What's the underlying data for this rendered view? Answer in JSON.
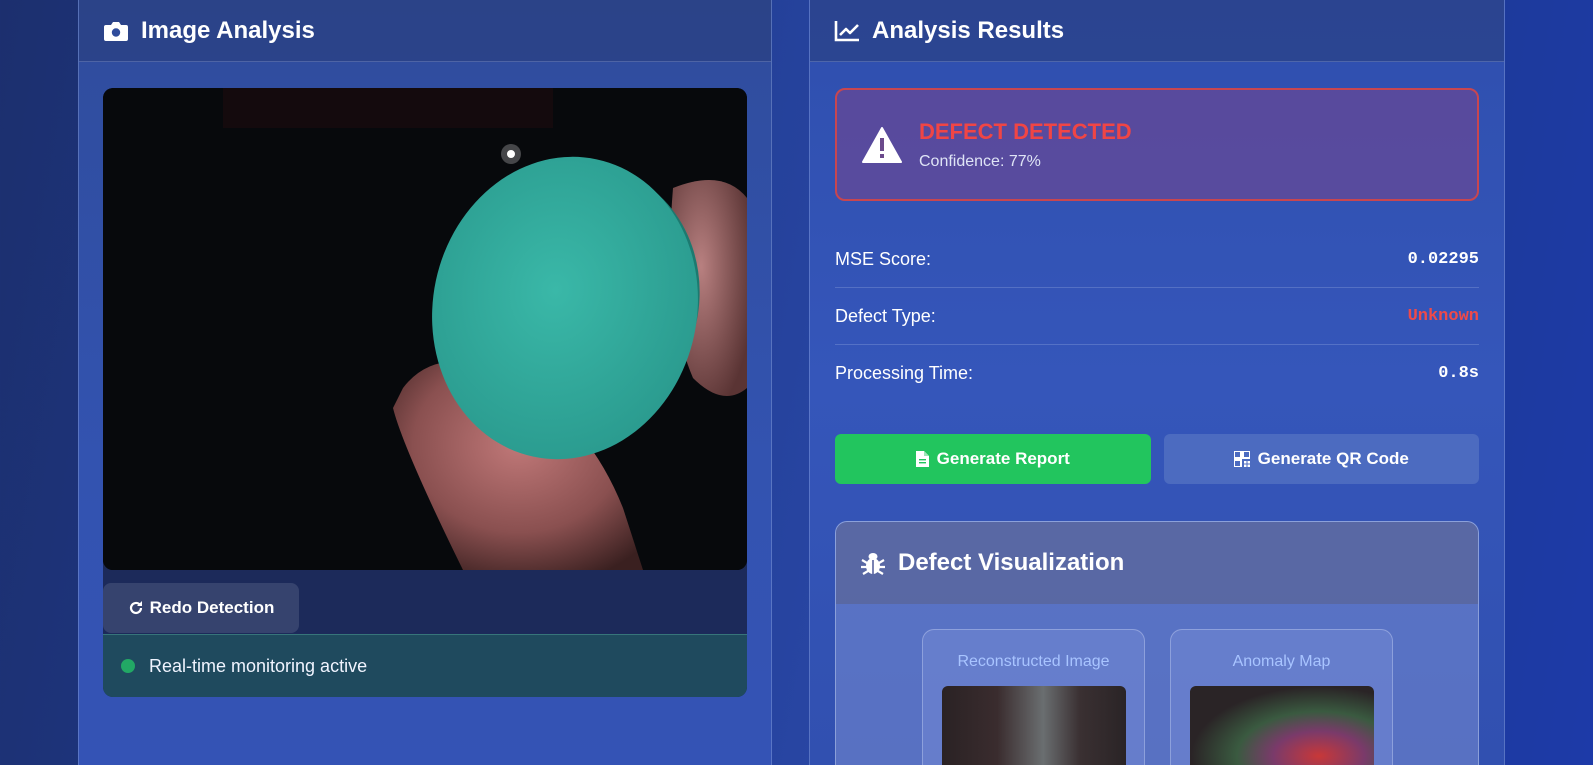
{
  "left_panel": {
    "title": "Image Analysis",
    "redo_button": "Redo Detection",
    "status_text": "Real-time monitoring active"
  },
  "right_panel": {
    "title": "Analysis Results",
    "alert": {
      "title": "DEFECT DETECTED",
      "confidence": "Confidence: 77%"
    },
    "metrics": [
      {
        "label": "MSE Score:",
        "value": "0.02295"
      },
      {
        "label": "Defect Type:",
        "value": "Unknown"
      },
      {
        "label": "Processing Time:",
        "value": "0.8s"
      }
    ],
    "buttons": {
      "report": "Generate Report",
      "qr": "Generate QR Code"
    },
    "visualization": {
      "title": "Defect Visualization",
      "cards": [
        {
          "label": "Reconstructed Image"
        },
        {
          "label": "Anomaly Map"
        }
      ]
    }
  },
  "colors": {
    "defect_red": "#f04545",
    "success_green": "#22c55e",
    "status_dot": "#22a865"
  }
}
